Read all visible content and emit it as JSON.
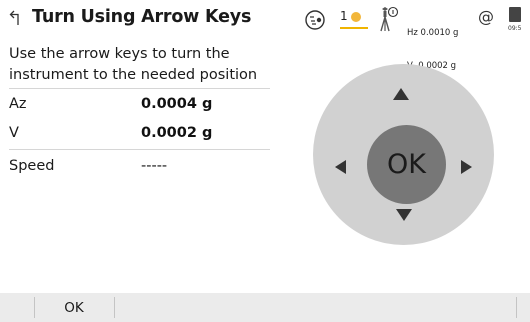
{
  "header": {
    "title": "Turn Using Arrow Keys",
    "status": {
      "counter": "1",
      "hz_line": "Hz 0.0010 g",
      "v_line": "V  0.0002 g",
      "at_symbol": "@",
      "time": "09:5"
    }
  },
  "instruction": "Use the arrow keys to turn the instrument to the needed position",
  "rows": [
    {
      "label": "Az",
      "value": "0.0004 g"
    },
    {
      "label": "V",
      "value": "0.0002 g"
    },
    {
      "label": "Speed",
      "value": "-----"
    }
  ],
  "pad": {
    "center_label": "OK"
  },
  "bottombar": {
    "ok_label": "OK"
  },
  "colors": {
    "pad_outer": "#d1d1d1",
    "pad_center": "#777777",
    "bottombar": "#ebebeb",
    "sun": "#f2b63a"
  },
  "icons": [
    "back-icon",
    "recording-icon",
    "sun-icon",
    "prism-icon",
    "at-icon",
    "battery-icon"
  ]
}
